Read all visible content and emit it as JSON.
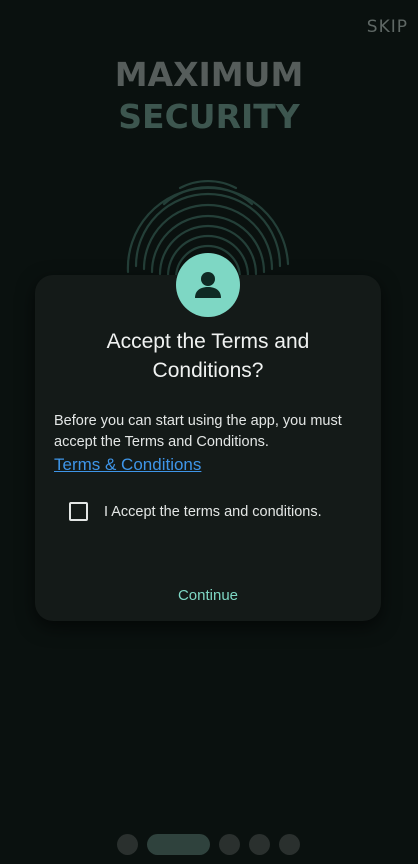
{
  "header": {
    "skip_label": "SKIP"
  },
  "hero": {
    "title_line1": "MAXIMUM",
    "title_line2": "SECURITY",
    "image_icon": "fingerprint-icon"
  },
  "dialog": {
    "icon": "person-icon",
    "title": "Accept the Terms and Conditions?",
    "body": "Before you can start using the app, you must accept the Terms and Conditions.",
    "link_label": "Terms & Conditions",
    "checkbox_label": "I Accept the terms and conditions.",
    "checkbox_checked": false,
    "continue_label": "Continue"
  },
  "pager": {
    "count": 5,
    "active_index": 1
  },
  "colors": {
    "background": "#0a110f",
    "dialog": "#141a18",
    "accent": "#7ed7c4",
    "link": "#3e95e8"
  }
}
